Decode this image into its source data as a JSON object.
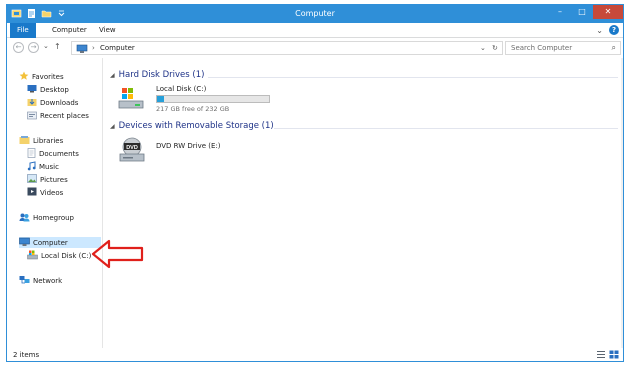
{
  "window": {
    "title": "Computer",
    "controls": {
      "minimize": "–",
      "maximize": "□",
      "close": "✕"
    }
  },
  "ribbon": {
    "tabs": [
      "File",
      "Computer",
      "View"
    ],
    "expand_glyph": "⌄",
    "help_glyph": "?"
  },
  "address": {
    "back": "←",
    "forward": "→",
    "recent": "⌄",
    "up": "↑",
    "separator": "›",
    "path": "Computer",
    "dropdown": "⌄",
    "refresh": "↻",
    "search_placeholder": "Search Computer",
    "search_glyph": "⌕"
  },
  "navpane": {
    "favorites": {
      "label": "Favorites",
      "items": [
        "Desktop",
        "Downloads",
        "Recent places"
      ]
    },
    "libraries": {
      "label": "Libraries",
      "items": [
        "Documents",
        "Music",
        "Pictures",
        "Videos"
      ]
    },
    "homegroup": "Homegroup",
    "computer": {
      "label": "Computer",
      "items": [
        "Local Disk (C:)"
      ]
    },
    "network": "Network"
  },
  "content": {
    "groups": [
      {
        "header": "Hard Disk Drives (1)",
        "drives": [
          {
            "name": "Local Disk (C:)",
            "free": "217 GB free of 232 GB",
            "used_fraction": 0.065
          }
        ]
      },
      {
        "header": "Devices with Removable Storage (1)",
        "drives": [
          {
            "name": "DVD RW Drive (E:)",
            "badge": "DVD"
          }
        ]
      }
    ]
  },
  "status": {
    "items": "2 items"
  },
  "colors": {
    "titlebar": "#2f8fd8",
    "file_tab": "#1979ca",
    "group_header": "#1e3287",
    "usage_fill": "#26a0da",
    "annotation_arrow": "#e0201b"
  }
}
